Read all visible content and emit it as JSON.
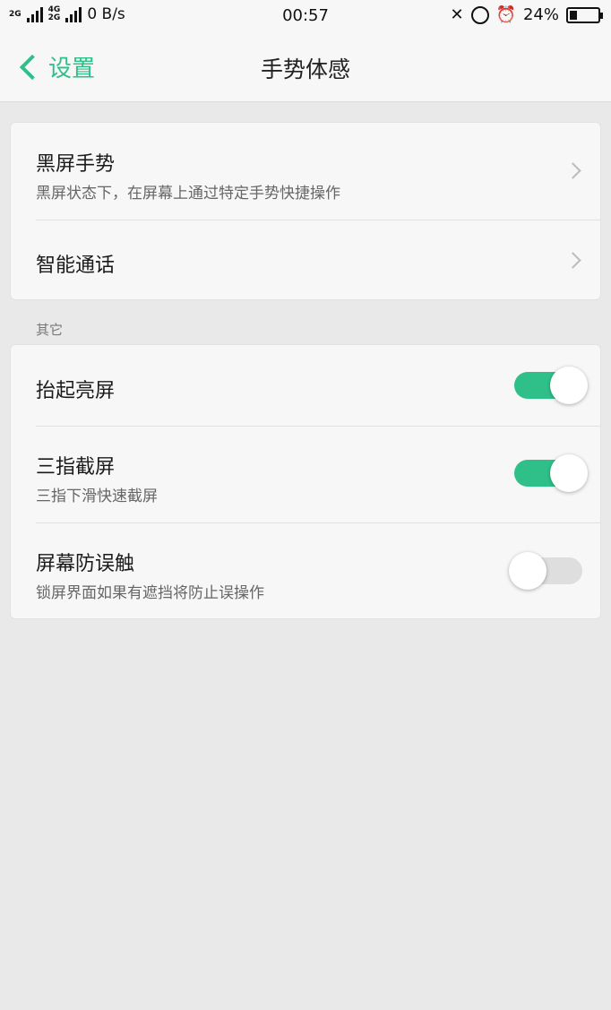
{
  "status_bar": {
    "net1": "2G",
    "net2_top": "4G",
    "net2_bottom": "2G",
    "speed": "0 B/s",
    "time": "00:57",
    "battery": "24%"
  },
  "nav": {
    "back_label": "设置",
    "title": "手势体感"
  },
  "group1": {
    "items": [
      {
        "title": "黑屏手势",
        "subtitle": "黑屏状态下，在屏幕上通过特定手势快捷操作"
      },
      {
        "title": "智能通话"
      }
    ]
  },
  "section_other": {
    "label": "其它",
    "items": [
      {
        "title": "抬起亮屏",
        "switch": "on"
      },
      {
        "title": "三指截屏",
        "subtitle": "三指下滑快速截屏",
        "switch": "on"
      },
      {
        "title": "屏幕防误触",
        "subtitle": "锁屏界面如果有遮挡将防止误操作",
        "switch": "off"
      }
    ]
  },
  "colors": {
    "accent": "#2fc08a",
    "background": "#e9e9e9",
    "card": "#f7f7f7"
  }
}
